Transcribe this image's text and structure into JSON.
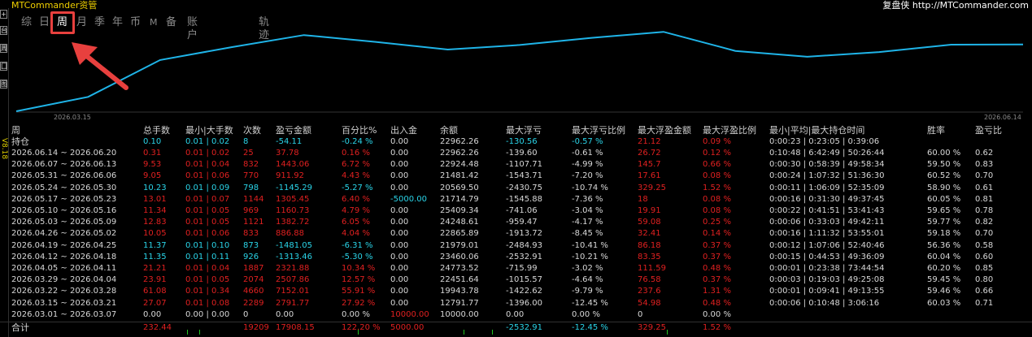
{
  "app": {
    "title": "MTCommander资管",
    "brand": "复盘侠 http://MTCommander.com",
    "version": "V8.18"
  },
  "toolbar_icons": [
    "+",
    "台",
    "周",
    "囗",
    "图"
  ],
  "tabs": [
    {
      "label": "综",
      "active": false
    },
    {
      "label": "日",
      "active": false
    },
    {
      "label": "周",
      "active": true
    },
    {
      "label": "月",
      "active": false
    },
    {
      "label": "季",
      "active": false
    },
    {
      "label": "年",
      "active": false
    },
    {
      "label": "币",
      "active": false
    },
    {
      "label": "M",
      "active": false
    },
    {
      "label": "备",
      "active": false
    },
    {
      "label": "账户",
      "active": false
    },
    {
      "label": "轨迹",
      "active": false
    }
  ],
  "colors": {
    "line": "#1fb4e8",
    "highlight": "#e8403e",
    "positive": "#e02020",
    "negative": "#2ad4e8"
  },
  "chart_data": {
    "type": "line",
    "x_labels": [
      "2026.03.15",
      "2026.06.14"
    ],
    "series": [
      {
        "values": [
          10000,
          12791.77,
          19943.78,
          22451.64,
          24773.52,
          23460.06,
          21979.01,
          22865.89,
          24248.61,
          25409.34,
          21714.79,
          20569.5,
          21481.42,
          22924.48,
          22962.26
        ]
      }
    ]
  },
  "table": {
    "headers": [
      "周",
      "总手数",
      "最小|大手数",
      "次数",
      "盈亏金额",
      "百分比%",
      "出入金",
      "余额",
      "最大浮亏",
      "最大浮亏比例",
      "最大浮盈金额",
      "最大浮盈比例",
      "最小|平均|最大持仓时间",
      "胜率",
      "盈亏比"
    ],
    "position_row": {
      "label": "持仓",
      "lots": "0.10",
      "minmax": "0.01 | 0.02",
      "count": "8",
      "pnl": "-54.11",
      "pct": "-0.24 %",
      "io": "0.00",
      "balance": "22962.26",
      "max_loss": "-130.56",
      "max_loss_pct": "-0.57 %",
      "max_gain": "21.12",
      "max_gain_pct": "0.09 %",
      "hold": "0:00:23 | 0:23:05 | 0:39:06"
    },
    "rows": [
      {
        "period": "2026.06.14 ~ 2026.06.20",
        "lots": "0.31",
        "minmax": "0.01 | 0.02",
        "count": "25",
        "pnl": "37.78",
        "pct": "0.16 %",
        "io": "0.00",
        "balance": "22962.26",
        "max_loss": "-139.60",
        "max_loss_pct": "-0.61 %",
        "max_gain": "26.72",
        "max_gain_pct": "0.12 %",
        "hold": "0:10:48 | 6:42:49 | 50:26:44",
        "win": "60.00 %",
        "ratio": "0.62",
        "pos": true
      },
      {
        "period": "2026.06.07 ~ 2026.06.13",
        "lots": "9.53",
        "minmax": "0.01 | 0.04",
        "count": "832",
        "pnl": "1443.06",
        "pct": "6.72 %",
        "io": "0.00",
        "balance": "22924.48",
        "max_loss": "-1107.71",
        "max_loss_pct": "-4.99 %",
        "max_gain": "145.7",
        "max_gain_pct": "0.66 %",
        "hold": "0:00:30 | 0:58:39 | 49:58:34",
        "win": "59.50 %",
        "ratio": "0.83",
        "pos": true
      },
      {
        "period": "2026.05.31 ~ 2026.06.06",
        "lots": "9.05",
        "minmax": "0.01 | 0.06",
        "count": "770",
        "pnl": "911.92",
        "pct": "4.43 %",
        "io": "0.00",
        "balance": "21481.42",
        "max_loss": "-1543.71",
        "max_loss_pct": "-7.20 %",
        "max_gain": "17.61",
        "max_gain_pct": "0.08 %",
        "hold": "0:00:24 | 1:07:32 | 51:36:30",
        "win": "60.52 %",
        "ratio": "0.70",
        "pos": true
      },
      {
        "period": "2026.05.24 ~ 2026.05.30",
        "lots": "10.23",
        "minmax": "0.01 | 0.09",
        "count": "798",
        "pnl": "-1145.29",
        "pct": "-5.27 %",
        "io": "0.00",
        "balance": "20569.50",
        "max_loss": "-2430.75",
        "max_loss_pct": "-10.74 %",
        "max_gain": "329.25",
        "max_gain_pct": "1.52 %",
        "hold": "0:00:11 | 1:06:09 | 52:35:09",
        "win": "58.90 %",
        "ratio": "0.61",
        "pos": false
      },
      {
        "period": "2026.05.17 ~ 2026.05.23",
        "lots": "13.01",
        "minmax": "0.01 | 0.07",
        "count": "1144",
        "pnl": "1305.45",
        "pct": "6.40 %",
        "io": "-5000.00",
        "balance": "21714.79",
        "max_loss": "-1545.88",
        "max_loss_pct": "-7.36 %",
        "max_gain": "18",
        "max_gain_pct": "0.08 %",
        "hold": "0:00:16 | 0:31:30 | 49:37:45",
        "win": "60.05 %",
        "ratio": "0.81",
        "pos": true
      },
      {
        "period": "2026.05.10 ~ 2026.05.16",
        "lots": "11.34",
        "minmax": "0.01 | 0.05",
        "count": "969",
        "pnl": "1160.73",
        "pct": "4.79 %",
        "io": "0.00",
        "balance": "25409.34",
        "max_loss": "-741.06",
        "max_loss_pct": "-3.04 %",
        "max_gain": "19.91",
        "max_gain_pct": "0.08 %",
        "hold": "0:00:22 | 0:41:51 | 53:41:43",
        "win": "59.65 %",
        "ratio": "0.78",
        "pos": true
      },
      {
        "period": "2026.05.03 ~ 2026.05.09",
        "lots": "12.83",
        "minmax": "0.01 | 0.05",
        "count": "1121",
        "pnl": "1382.72",
        "pct": "6.05 %",
        "io": "0.00",
        "balance": "24248.61",
        "max_loss": "-959.47",
        "max_loss_pct": "-4.17 %",
        "max_gain": "59.08",
        "max_gain_pct": "0.25 %",
        "hold": "0:00:06 | 0:33:03 | 49:42:11",
        "win": "59.77 %",
        "ratio": "0.82",
        "pos": true
      },
      {
        "period": "2026.04.26 ~ 2026.05.02",
        "lots": "10.05",
        "minmax": "0.01 | 0.06",
        "count": "833",
        "pnl": "886.88",
        "pct": "4.04 %",
        "io": "0.00",
        "balance": "22865.89",
        "max_loss": "-1913.72",
        "max_loss_pct": "-8.45 %",
        "max_gain": "32.41",
        "max_gain_pct": "0.14 %",
        "hold": "0:00:16 | 1:11:32 | 53:55:01",
        "win": "59.18 %",
        "ratio": "0.70",
        "pos": true
      },
      {
        "period": "2026.04.19 ~ 2026.04.25",
        "lots": "11.37",
        "minmax": "0.01 | 0.10",
        "count": "873",
        "pnl": "-1481.05",
        "pct": "-6.31 %",
        "io": "0.00",
        "balance": "21979.01",
        "max_loss": "-2484.93",
        "max_loss_pct": "-10.41 %",
        "max_gain": "86.18",
        "max_gain_pct": "0.37 %",
        "hold": "0:00:12 | 1:07:06 | 52:40:46",
        "win": "56.36 %",
        "ratio": "0.58",
        "pos": false
      },
      {
        "period": "2026.04.12 ~ 2026.04.18",
        "lots": "11.35",
        "minmax": "0.01 | 0.11",
        "count": "926",
        "pnl": "-1313.46",
        "pct": "-5.30 %",
        "io": "0.00",
        "balance": "23460.06",
        "max_loss": "-2532.91",
        "max_loss_pct": "-10.21 %",
        "max_gain": "83.35",
        "max_gain_pct": "0.37 %",
        "hold": "0:00:15 | 0:44:53 | 49:36:09",
        "win": "60.04 %",
        "ratio": "0.60",
        "pos": false
      },
      {
        "period": "2026.04.05 ~ 2026.04.11",
        "lots": "21.21",
        "minmax": "0.01 | 0.04",
        "count": "1887",
        "pnl": "2321.88",
        "pct": "10.34 %",
        "io": "0.00",
        "balance": "24773.52",
        "max_loss": "-715.99",
        "max_loss_pct": "-3.02 %",
        "max_gain": "111.59",
        "max_gain_pct": "0.48 %",
        "hold": "0:00:01 | 0:23:38 | 73:44:54",
        "win": "60.20 %",
        "ratio": "0.85",
        "pos": true
      },
      {
        "period": "2026.03.29 ~ 2026.04.04",
        "lots": "23.91",
        "minmax": "0.01 | 0.05",
        "count": "2074",
        "pnl": "2507.86",
        "pct": "12.57 %",
        "io": "0.00",
        "balance": "22451.64",
        "max_loss": "-1015.57",
        "max_loss_pct": "-4.64 %",
        "max_gain": "76.58",
        "max_gain_pct": "0.37 %",
        "hold": "0:00:03 | 0:19:03 | 49:25:08",
        "win": "59.45 %",
        "ratio": "0.80",
        "pos": true
      },
      {
        "period": "2026.03.22 ~ 2026.03.28",
        "lots": "61.08",
        "minmax": "0.01 | 0.34",
        "count": "4660",
        "pnl": "7152.01",
        "pct": "55.91 %",
        "io": "0.00",
        "balance": "19943.78",
        "max_loss": "-1422.62",
        "max_loss_pct": "-9.79 %",
        "max_gain": "237.6",
        "max_gain_pct": "1.31 %",
        "hold": "0:00:01 | 0:09:41 | 49:13:55",
        "win": "59.46 %",
        "ratio": "0.66",
        "pos": true
      },
      {
        "period": "2026.03.15 ~ 2026.03.21",
        "lots": "27.07",
        "minmax": "0.01 | 0.08",
        "count": "2289",
        "pnl": "2791.77",
        "pct": "27.92 %",
        "io": "0.00",
        "balance": "12791.77",
        "max_loss": "-1396.00",
        "max_loss_pct": "-12.45 %",
        "max_gain": "54.98",
        "max_gain_pct": "0.48 %",
        "hold": "0:00:06 | 0:10:48 | 3:06:16",
        "win": "60.03 %",
        "ratio": "0.71",
        "pos": true
      },
      {
        "period": "2026.03.01 ~ 2026.03.07",
        "lots": "0.00",
        "minmax": "0.00 | 0.00",
        "count": "0",
        "pnl": "0.00",
        "pct": "0.00 %",
        "io": "10000.00",
        "balance": "10000.00",
        "max_loss": "0.00",
        "max_loss_pct": "0.00 %",
        "max_gain": "0",
        "max_gain_pct": "0.00 %",
        "hold": "",
        "win": "",
        "ratio": "",
        "pos": null
      }
    ],
    "total": {
      "label": "合计",
      "lots": "232.44",
      "count": "19209",
      "pnl": "17908.15",
      "pct": "122.20 %",
      "io": "5000.00",
      "max_loss": "-2532.91",
      "max_loss_pct": "-12.45 %",
      "max_gain": "329.25",
      "max_gain_pct": "1.52 %"
    }
  }
}
